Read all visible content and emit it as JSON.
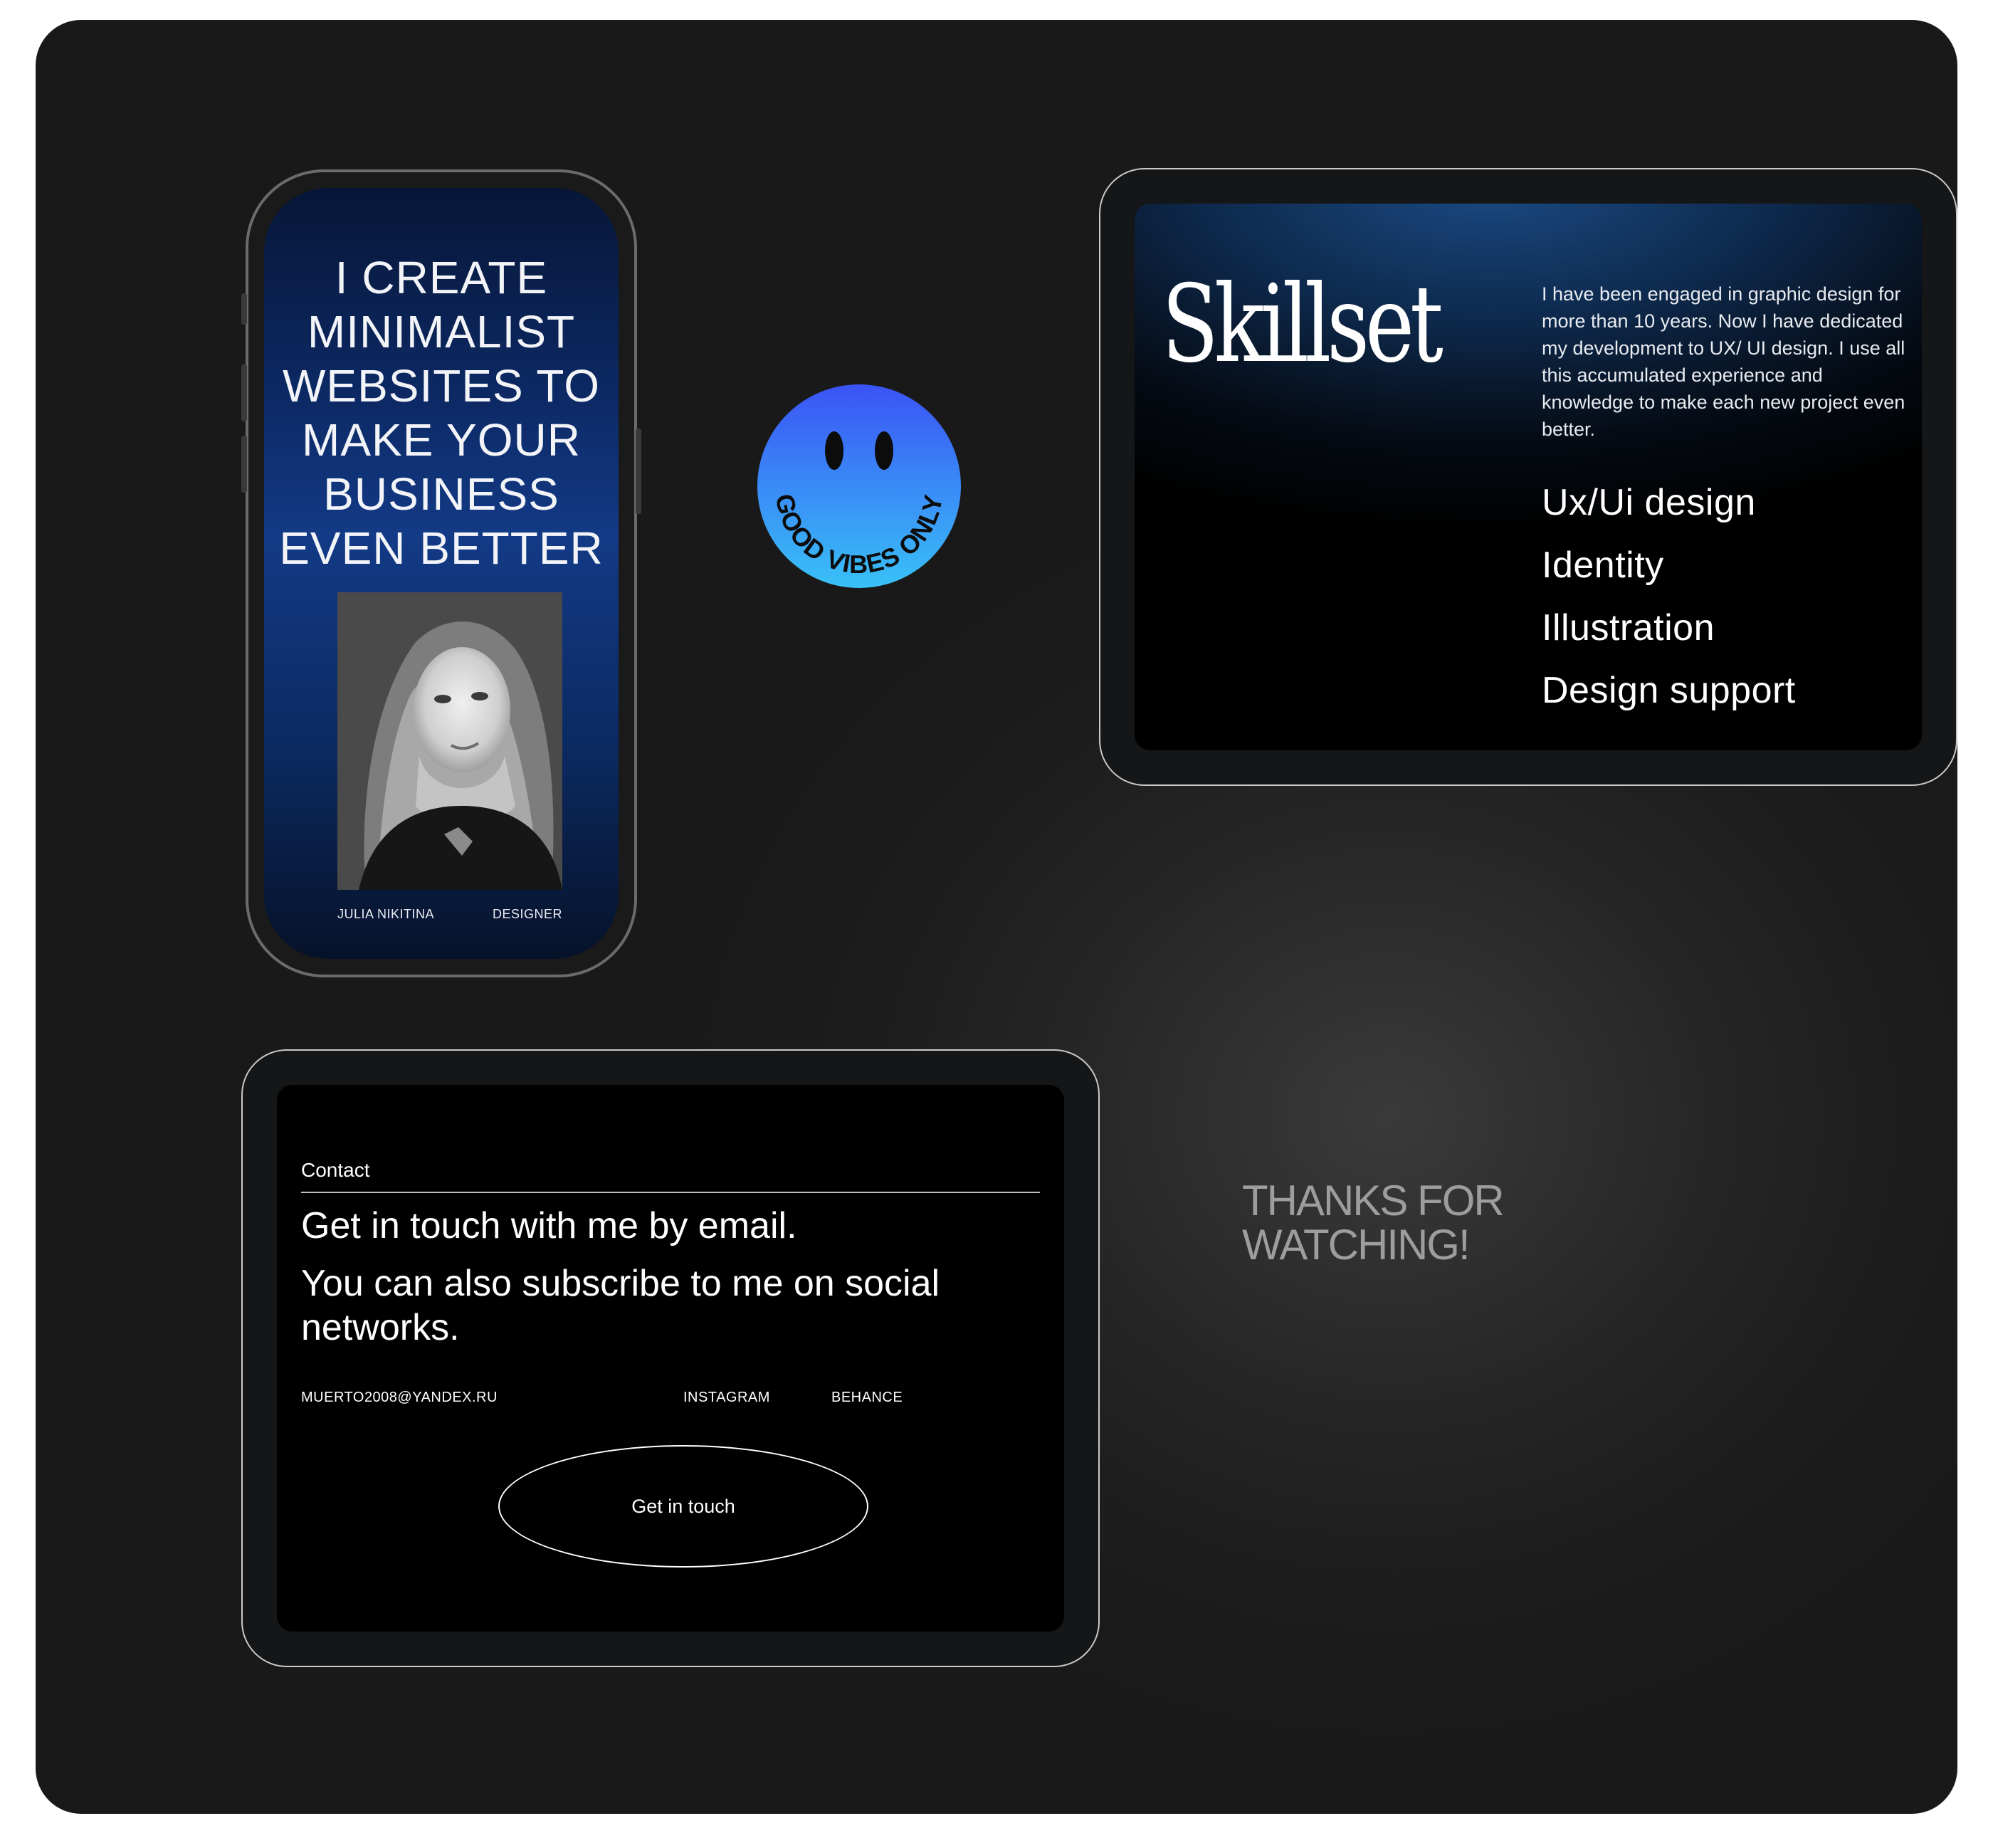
{
  "phone": {
    "headline": [
      "I CREATE",
      "MINIMALIST",
      "WEBSITES TO",
      "MAKE YOUR",
      "BUSINESS",
      "EVEN BETTER"
    ],
    "name": "JULIA NIKITINA",
    "role": "DESIGNER"
  },
  "sticker": {
    "text": "GOOD VIBES ONLY"
  },
  "skillset": {
    "title": "Skillset",
    "description": "I have been engaged in graphic design for more than 10 years. Now I have dedicated my development to UX/ UI design. I use all this accumulated experience and knowledge to make each new project even better.",
    "items": [
      "Ux/Ui design",
      "Identity",
      "Illustration",
      "Design support"
    ]
  },
  "contact": {
    "label": "Contact",
    "line1": "Get in touch with me by email.",
    "line2": "You can also subscribe to me on social networks.",
    "email": "MUERTO2008@YANDEX.RU",
    "instagram": "INSTAGRAM",
    "behance": "BEHANCE",
    "button": "Get in touch"
  },
  "closing": {
    "line1": "THANKS FOR",
    "line2": "WATCHING!"
  },
  "colors": {
    "board": "#1c1c1c",
    "sticker_top": "#3b53f5",
    "sticker_bottom": "#39c1f7",
    "thanks_text": "#9d9d9d"
  }
}
